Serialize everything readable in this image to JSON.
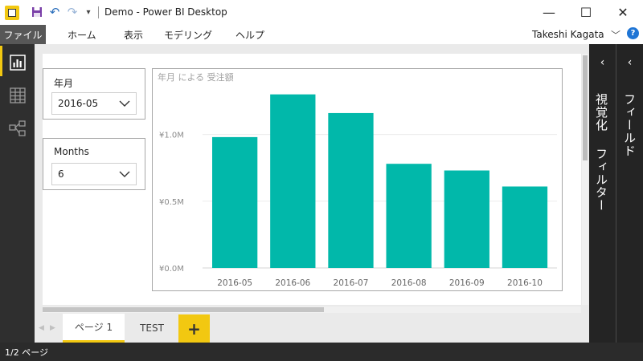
{
  "window": {
    "title": "Demo - Power BI Desktop",
    "minimize_glyph": "—",
    "maximize_glyph": "☐",
    "close_glyph": "✕"
  },
  "quick_access": {
    "undo_glyph": "↶",
    "redo_glyph": "↷",
    "more_glyph": "▾"
  },
  "ribbon": {
    "file": "ファイル",
    "tabs": [
      "ホーム",
      "表示",
      "モデリング",
      "ヘルプ"
    ],
    "user": "Takeshi Kagata",
    "collapse_glyph": "﹀",
    "help_glyph": "?"
  },
  "slicers": [
    {
      "title": "年月",
      "value": "2016-05"
    },
    {
      "title": "Months",
      "value": "6"
    }
  ],
  "chart_data": {
    "type": "bar",
    "title": "年月 による 受注額",
    "categories": [
      "2016-05",
      "2016-06",
      "2016-07",
      "2016-08",
      "2016-09",
      "2016-10"
    ],
    "values": [
      0.98,
      1.3,
      1.16,
      0.78,
      0.73,
      0.61
    ],
    "unit": "¥M",
    "yticks": [
      "¥0.0M",
      "¥0.5M",
      "¥1.0M"
    ],
    "ytick_values": [
      0,
      0.5,
      1.0
    ],
    "ylim": [
      0,
      1.4
    ],
    "grid": true,
    "bar_color": "#01b8aa"
  },
  "page_tabs": [
    "ページ 1",
    "TEST"
  ],
  "add_page_glyph": "+",
  "panes": {
    "visualizations": "視覚化",
    "filters": "フィルター",
    "fields": "フィールド",
    "collapse_glyph": "‹"
  },
  "status": "1/2 ページ",
  "colors": {
    "accent": "#f2c811",
    "bar": "#01b8aa",
    "rail": "#2f2f2f",
    "pane": "#242424"
  }
}
